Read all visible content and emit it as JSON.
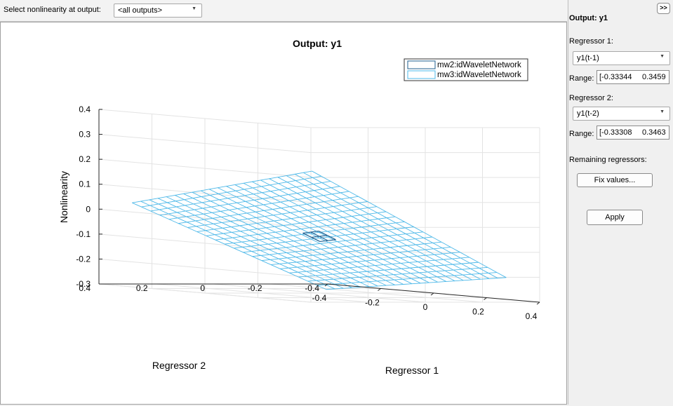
{
  "toolbar": {
    "select_label": "Select nonlinearity at output:",
    "select_value": "<all outputs>"
  },
  "side": {
    "collapse_label": ">>",
    "output_title": "Output: y1",
    "reg1_label": "Regressor 1:",
    "reg1_value": "y1(t-1)",
    "range_label": "Range:",
    "reg1_range_min": "[-0.33344",
    "reg1_range_max": "0.3459",
    "reg2_label": "Regressor 2:",
    "reg2_value": "y1(t-2)",
    "reg2_range_min": "[-0.33308",
    "reg2_range_max": "0.3463",
    "remaining_label": "Remaining regressors:",
    "fix_label": "Fix values...",
    "apply_label": "Apply"
  },
  "colors": {
    "series1": "#1f5f8f",
    "series2": "#4db8e8"
  },
  "chart_data": {
    "type": "surface",
    "title": "Output: y1",
    "xlabel": "Regressor 1",
    "ylabel": "Regressor 2",
    "zlabel": "Nonlinearity",
    "xlim": [
      -0.4,
      0.4
    ],
    "ylim": [
      -0.4,
      0.4
    ],
    "zlim": [
      -0.3,
      0.4
    ],
    "x_ticks": [
      "-0.4",
      "-0.2",
      "0",
      "0.2",
      "0.4"
    ],
    "y_ticks": [
      "-0.4",
      "-0.2",
      "0",
      "0.2",
      "0.4"
    ],
    "z_ticks": [
      "-0.3",
      "-0.2",
      "-0.1",
      "0",
      "0.1",
      "0.2",
      "0.3",
      "0.4"
    ],
    "grid": true,
    "legend": [
      "mw2:idWaveletNetwork",
      "mw3:idWaveletNetwork"
    ],
    "legend_position": "top-right",
    "series": [
      {
        "name": "mw2:idWaveletNetwork",
        "x_range": [
          -0.03,
          0.03
        ],
        "y_range": [
          -0.03,
          0.03
        ]
      },
      {
        "name": "mw3:idWaveletNetwork",
        "x_range": [
          -0.333,
          0.346
        ],
        "y_range": [
          -0.333,
          0.346
        ],
        "grid_points": 22
      }
    ],
    "surface_corners_z": {
      "x_min_y_min": -0.36,
      "x_max_y_min": -0.24,
      "x_min_y_max": 0.04,
      "x_max_y_max": 0.27
    }
  }
}
